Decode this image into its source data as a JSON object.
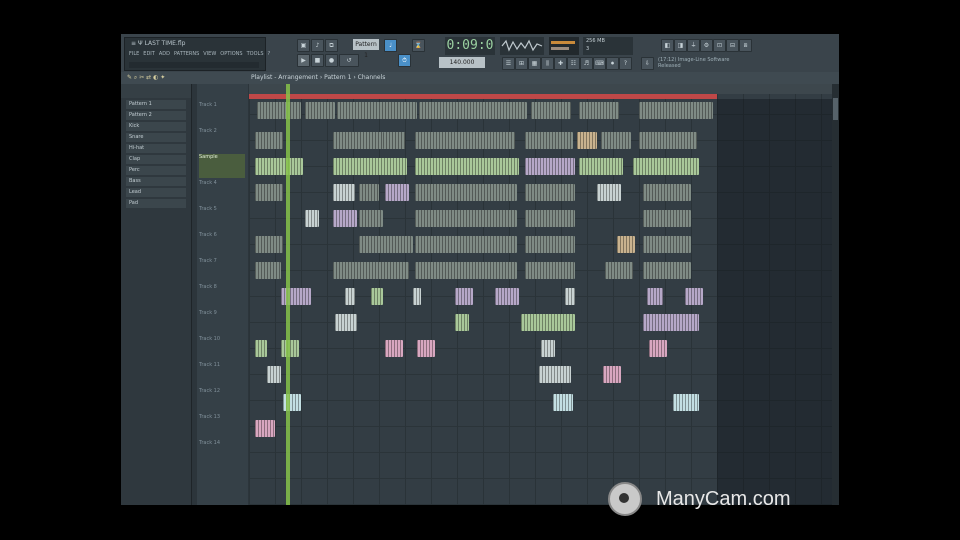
{
  "window": {
    "title": "≡ Ψ  LAST TIME.flp"
  },
  "menu": [
    "FILE",
    "EDIT",
    "ADD",
    "PATTERNS",
    "VIEW",
    "OPTIONS",
    "TOOLS",
    "?"
  ],
  "transport": {
    "time": "0:09:0",
    "tempo": "140.000",
    "pattern_label": "Pattern 1"
  },
  "memory": {
    "line1": "256 MB",
    "line2": "3"
  },
  "info": {
    "line1": "(17:12) Image-Line Software",
    "line2": "Released"
  },
  "playlist": {
    "title": "Playlist - Arrangement › Pattern 1 › Channels"
  },
  "browser": {
    "items": [
      "Pattern 1",
      "Pattern 2",
      "Kick",
      "Snare",
      "Hi-hat",
      "Clap",
      "Perc",
      "Bass",
      "Lead",
      "Pad"
    ]
  },
  "tracks": [
    "Track 1",
    "Track 2",
    "Track 3",
    "Track 4",
    "Track 5",
    "Track 6",
    "Track 7",
    "Track 8",
    "Track 9",
    "Track 10",
    "Track 11",
    "Track 12",
    "Track 13",
    "Track 14"
  ],
  "selected_track_label": "Sample",
  "watermark": "ManyCam.com",
  "colors": {
    "loop": "#c04848",
    "playhead": "#86c24a",
    "clip_green": "#a9c89a",
    "clip_pink": "#d8a7c0"
  }
}
